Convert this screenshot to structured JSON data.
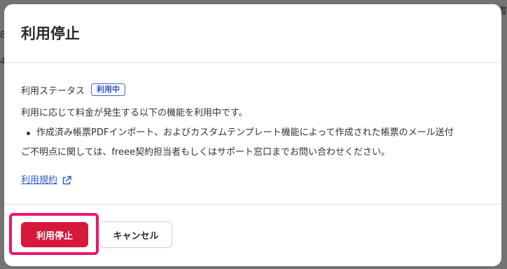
{
  "modal": {
    "title": "利用停止",
    "status_label": "利用ステータス",
    "status_badge": "利用中",
    "description": "利用に応じて料金が発生する以下の機能を利用中です。",
    "features": [
      "作成済み帳票PDFインポート、およびカスタムテンプレート機能によって作成された帳票のメール送付"
    ],
    "inquiry": "ご不明点に関しては、freee契約担当者もしくはサポート窓口までお問い合わせください。",
    "terms_link": "利用規約",
    "terms_icon": "external-link-icon",
    "stop_button": "利用停止",
    "cancel_button": "キャンセル"
  },
  "background": {
    "fragments": [
      "書",
      "8",
      "4"
    ]
  },
  "colors": {
    "primary_danger": "#d6193a",
    "highlight": "#e8166a",
    "badge_blue": "#3f64c8",
    "link": "#2f5bd0",
    "overlay": "#737373"
  }
}
